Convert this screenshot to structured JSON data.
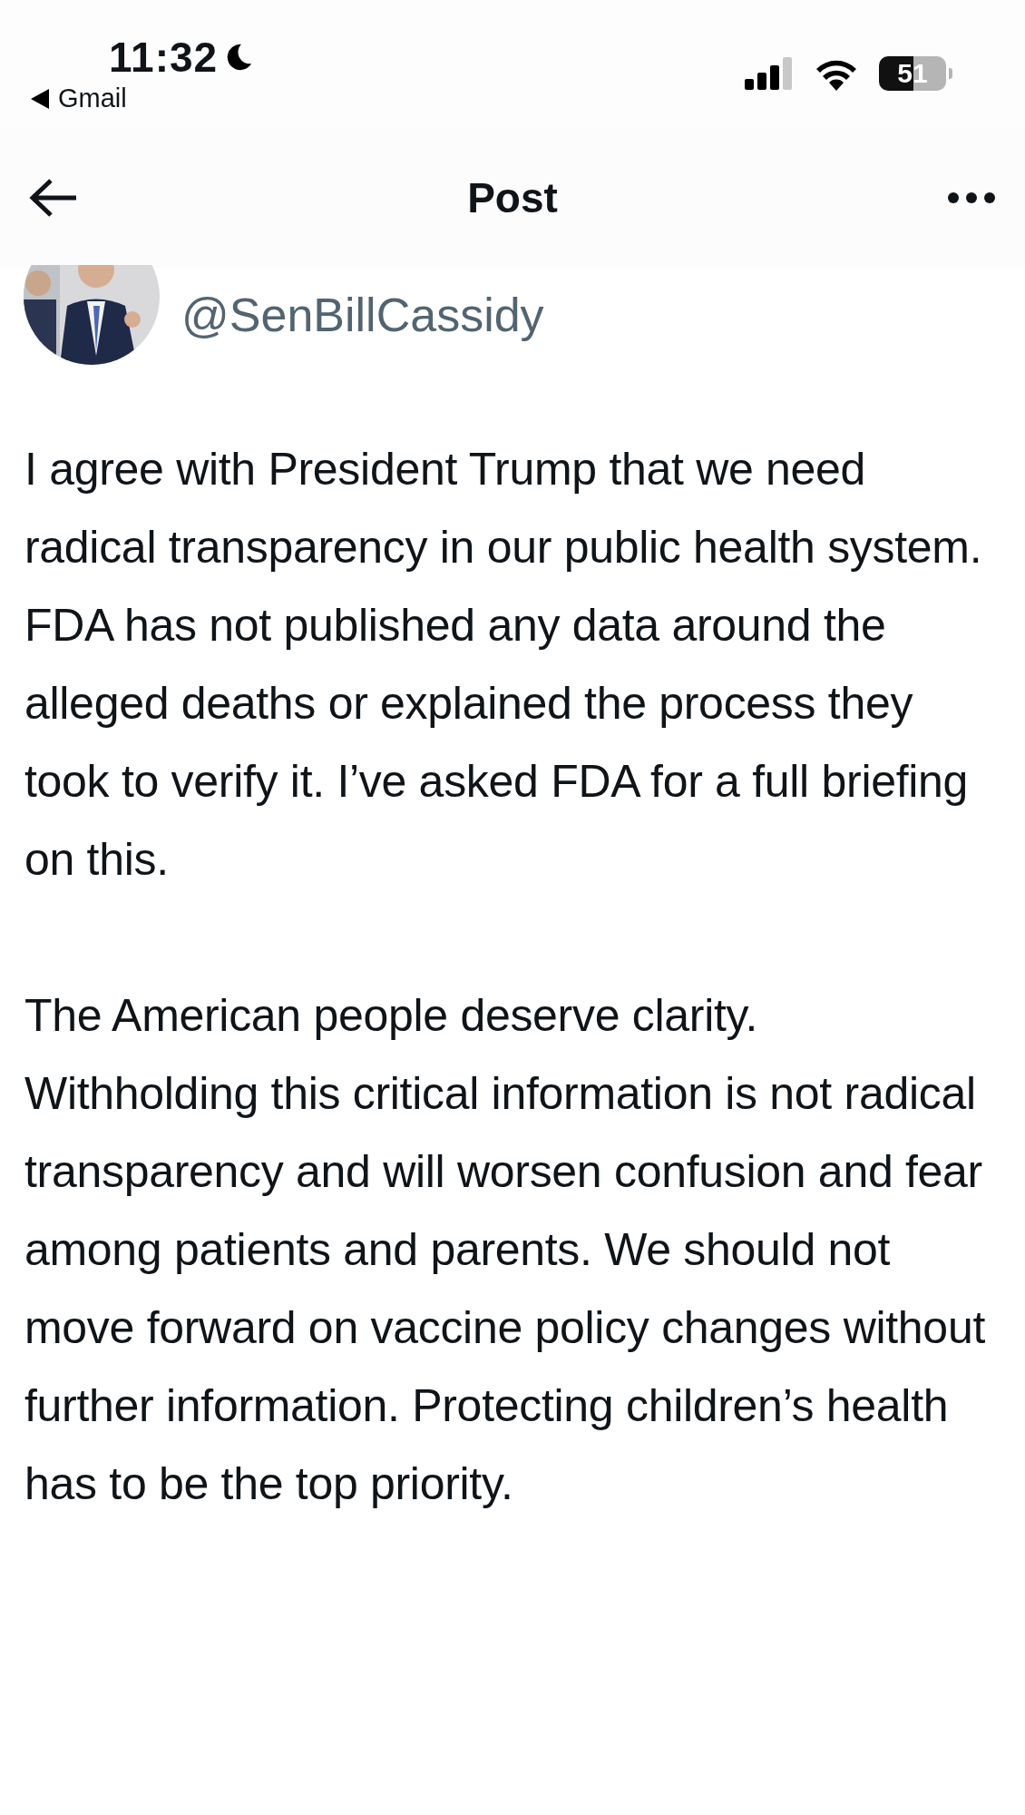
{
  "status_bar": {
    "time": "11:32",
    "back_app": "Gmail",
    "battery": "51"
  },
  "header": {
    "title": "Post"
  },
  "post": {
    "handle": "@SenBillCassidy",
    "paragraphs": [
      "I agree with President Trump that we need radical transparency in our public health system. FDA has not published any data around the alleged deaths or explained the process they took to verify it. I’ve asked FDA for a full briefing on this.",
      "The American people deserve clarity. Withholding this critical information is not radical transparency and will worsen confusion and fear among patients and parents. We should not move forward on vaccine policy changes without further information. Protecting children’s health has to be the top priority."
    ]
  }
}
